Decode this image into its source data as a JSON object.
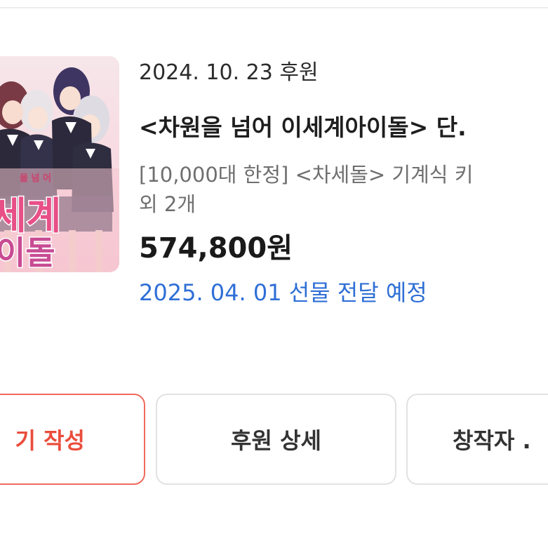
{
  "pledge": {
    "date_line": "2024. 10. 23 후원",
    "title": "<차원을 넘어 이세계아이돌> 단.",
    "options_line1": "[10,000대 한정] <차세돌> 기계식 키",
    "options_line2": "외 2개",
    "price": "574,800원",
    "delivery": "2025. 04. 01 선물 전달 예정"
  },
  "thumbnail": {
    "cover_small": "을 넘 어",
    "cover_line1": "세계",
    "cover_line2": "이돌"
  },
  "actions": {
    "review_label": "기 작성",
    "detail_label": "후원 상세",
    "creator_label": "창작자 ."
  },
  "colors": {
    "accent_red": "#ea4d3c",
    "link_blue": "#2f6fd6"
  }
}
